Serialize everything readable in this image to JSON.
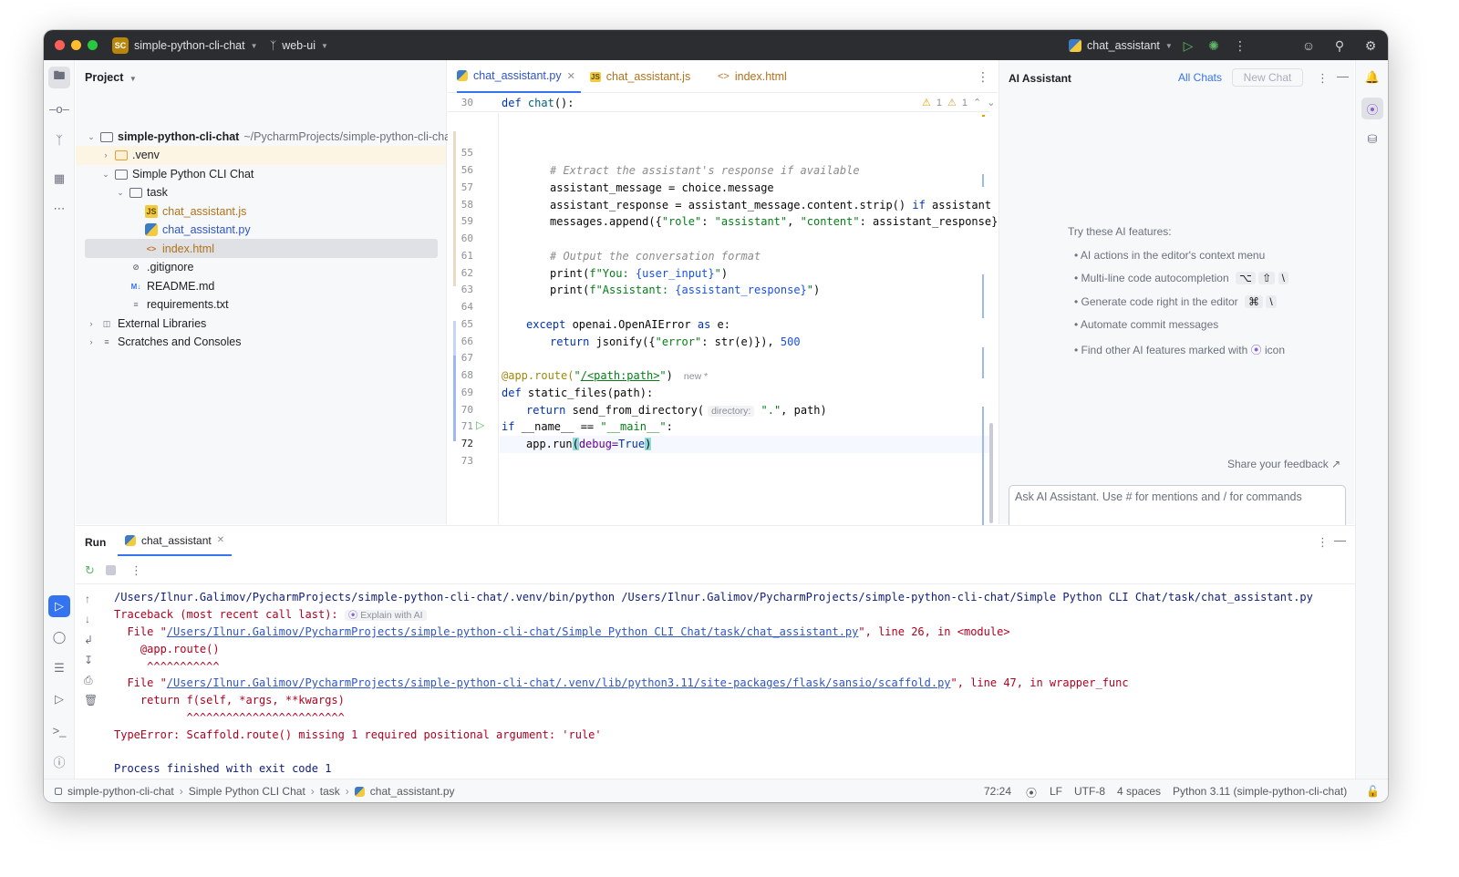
{
  "titlebar": {
    "project_badge": "SC",
    "project_name": "simple-python-cli-chat",
    "branch": "web-ui",
    "run_config": "chat_assistant"
  },
  "project_panel": {
    "header": "Project",
    "root_name": "simple-python-cli-chat",
    "root_path": "~/PycharmProjects/simple-python-cli-chat",
    "items": [
      {
        "label": ".venv"
      },
      {
        "label": "Simple Python CLI Chat"
      },
      {
        "label": "task"
      },
      {
        "label": "chat_assistant.js"
      },
      {
        "label": "chat_assistant.py"
      },
      {
        "label": "index.html"
      },
      {
        "label": ".gitignore"
      },
      {
        "label": "README.md"
      },
      {
        "label": "requirements.txt"
      },
      {
        "label": "External Libraries"
      },
      {
        "label": "Scratches and Consoles"
      }
    ]
  },
  "editor": {
    "tabs": [
      {
        "label": "chat_assistant.py"
      },
      {
        "label": "chat_assistant.js"
      },
      {
        "label": "index.html"
      }
    ],
    "inspections": {
      "warnings": "1",
      "weak_warnings": "1"
    },
    "sticky_line": {
      "num": "30",
      "code": "def chat():"
    },
    "line_numbers": [
      "55",
      "56",
      "57",
      "58",
      "59",
      "60",
      "61",
      "62",
      "63",
      "64",
      "65",
      "66",
      "67",
      "68",
      "69",
      "70",
      "71",
      "72",
      "73"
    ],
    "code": {
      "l56": "# Extract the assistant's response if available",
      "l57": "assistant_message = choice.message",
      "l58_a": "assistant_response = assistant_message.content.strip() ",
      "l58_b": "if",
      "l58_c": " assistant_messag",
      "l59_a": "messages.append({",
      "l59_b": "\"role\"",
      "l59_c": ": ",
      "l59_d": "\"assistant\"",
      "l59_e": ", ",
      "l59_f": "\"content\"",
      "l59_g": ": assistant_response})",
      "l61": "# Output the conversation format",
      "l62_a": "print(",
      "l62_b": "f\"You: ",
      "l62_c": "{user_input}",
      "l62_d": "\"",
      "l62_e": ")",
      "l63_a": "print(",
      "l63_b": "f\"Assistant: ",
      "l63_c": "{assistant_response}",
      "l63_d": "\"",
      "l63_e": ")",
      "l65_a": "except",
      "l65_b": " openai.OpenAIError ",
      "l65_c": "as",
      "l65_d": " e:",
      "l66_a": "return",
      "l66_b": " jsonify({",
      "l66_c": "\"error\"",
      "l66_d": ": str(e)}), ",
      "l66_e": "500",
      "l68_a": "@app.route(",
      "l68_b": "\"",
      "l68_c": "/<path:path>",
      "l68_d": "\"",
      "l68_e": ")",
      "l68_new": "new *",
      "l69_a": "def",
      "l69_b": " static_files(path):",
      "l70_a": "return",
      "l70_b": " send_from_directory(",
      "l70_hint": "directory:",
      "l70_c": " \".\"",
      "l70_d": ", path)",
      "l71_a": "if",
      "l71_b": " __name__ == ",
      "l71_c": "\"__main__\"",
      "l71_d": ":",
      "l72_a": "app.run",
      "l72_b": "(",
      "l72_c": "debug=",
      "l72_d": "True",
      "l72_e": ")"
    }
  },
  "ai_assistant": {
    "title": "AI Assistant",
    "all_chats": "All Chats",
    "new_chat": "New Chat",
    "try_title": "Try these AI features:",
    "features": [
      "AI actions in the editor's context menu",
      "Multi-line code autocompletion",
      "Generate code right in the editor",
      "Automate commit messages",
      "Find other AI features marked with"
    ],
    "icon_word": "icon",
    "feedback": "Share your feedback",
    "input_placeholder": "Ask AI Assistant. Use # for mentions and / for commands",
    "hash": "#"
  },
  "run_panel": {
    "title": "Run",
    "tab": "chat_assistant",
    "output": {
      "cmd": "/Users/Ilnur.Galimov/PycharmProjects/simple-python-cli-chat/.venv/bin/python /Users/Ilnur.Galimov/PycharmProjects/simple-python-cli-chat/Simple Python CLI Chat/task/chat_assistant.py",
      "traceback": "Traceback (most recent call last):",
      "explain": "Explain with AI",
      "file1_pre": "  File \"",
      "file1_link": "/Users/Ilnur.Galimov/PycharmProjects/simple-python-cli-chat/Simple Python CLI Chat/task/chat_assistant.py",
      "file1_post": "\", line 26, in <module>",
      "deco": "    @app.route()",
      "caret1": "     ^^^^^^^^^^^",
      "file2_pre": "  File \"",
      "file2_link": "/Users/Ilnur.Galimov/PycharmProjects/simple-python-cli-chat/.venv/lib/python3.11/site-packages/flask/sansio/scaffold.py",
      "file2_post": "\", line 47, in wrapper_func",
      "return_line": "    return f(self, *args, **kwargs)",
      "caret2": "           ^^^^^^^^^^^^^^^^^^^^^^^^",
      "error": "TypeError: Scaffold.route() missing 1 required positional argument: 'rule'",
      "finished": "Process finished with exit code 1"
    }
  },
  "statusbar": {
    "crumbs": [
      "simple-python-cli-chat",
      "Simple Python CLI Chat",
      "task",
      "chat_assistant.py"
    ],
    "position": "72:24",
    "line_sep": "LF",
    "encoding": "UTF-8",
    "indent": "4 spaces",
    "interpreter": "Python 3.11 (simple-python-cli-chat)"
  }
}
